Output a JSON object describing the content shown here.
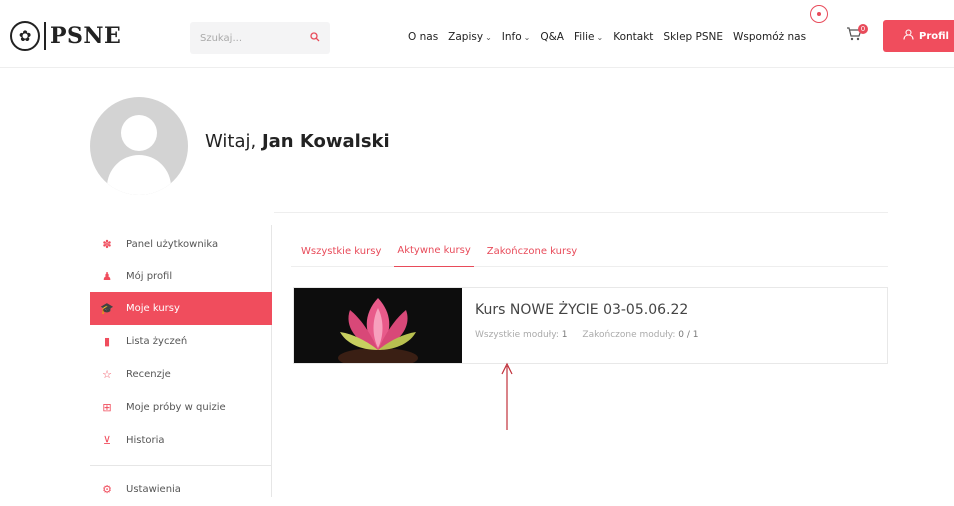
{
  "header": {
    "logo_text": "PSNE",
    "search_placeholder": "Szukaj...",
    "nav": [
      {
        "label": "O nas",
        "dropdown": false
      },
      {
        "label": "Zapisy",
        "dropdown": true
      },
      {
        "label": "Info",
        "dropdown": true
      },
      {
        "label": "Q&A",
        "dropdown": false
      },
      {
        "label": "Filie",
        "dropdown": true
      },
      {
        "label": "Kontakt",
        "dropdown": false
      },
      {
        "label": "Sklep PSNE",
        "dropdown": false
      },
      {
        "label": "Wspomóż nas",
        "dropdown": false
      }
    ],
    "cart_count": "0",
    "profile_label": "Profil",
    "accent_color": "#f04d5d"
  },
  "greeting": {
    "prefix": "Witaj,",
    "name": "Jan Kowalski"
  },
  "sidebar": {
    "items": [
      {
        "label": "Panel użytkownika",
        "icon": "dashboard-icon",
        "active": false
      },
      {
        "label": "Mój profil",
        "icon": "user-icon",
        "active": false
      },
      {
        "label": "Moje kursy",
        "icon": "graduation-cap-icon",
        "active": true
      },
      {
        "label": "Lista życzeń",
        "icon": "bookmark-icon",
        "active": false
      },
      {
        "label": "Recenzje",
        "icon": "star-icon",
        "active": false
      },
      {
        "label": "Moje próby w quizie",
        "icon": "sitemap-icon",
        "active": false
      },
      {
        "label": "Historia",
        "icon": "cart-icon",
        "active": false
      },
      {
        "label": "Ustawienia",
        "icon": "gear-icon",
        "active": false
      }
    ]
  },
  "tabs": [
    {
      "label": "Wszystkie kursy",
      "active": false
    },
    {
      "label": "Aktywne kursy",
      "active": true
    },
    {
      "label": "Zakończone kursy",
      "active": false
    }
  ],
  "course": {
    "title": "Kurs NOWE ŻYCIE 03-05.06.22",
    "all_modules_label": "Wszystkie moduły:",
    "all_modules_value": "1",
    "completed_modules_label": "Zakończone moduły:",
    "completed_modules_value": "0 / 1",
    "thumbnail": "lotus-flower-image"
  }
}
